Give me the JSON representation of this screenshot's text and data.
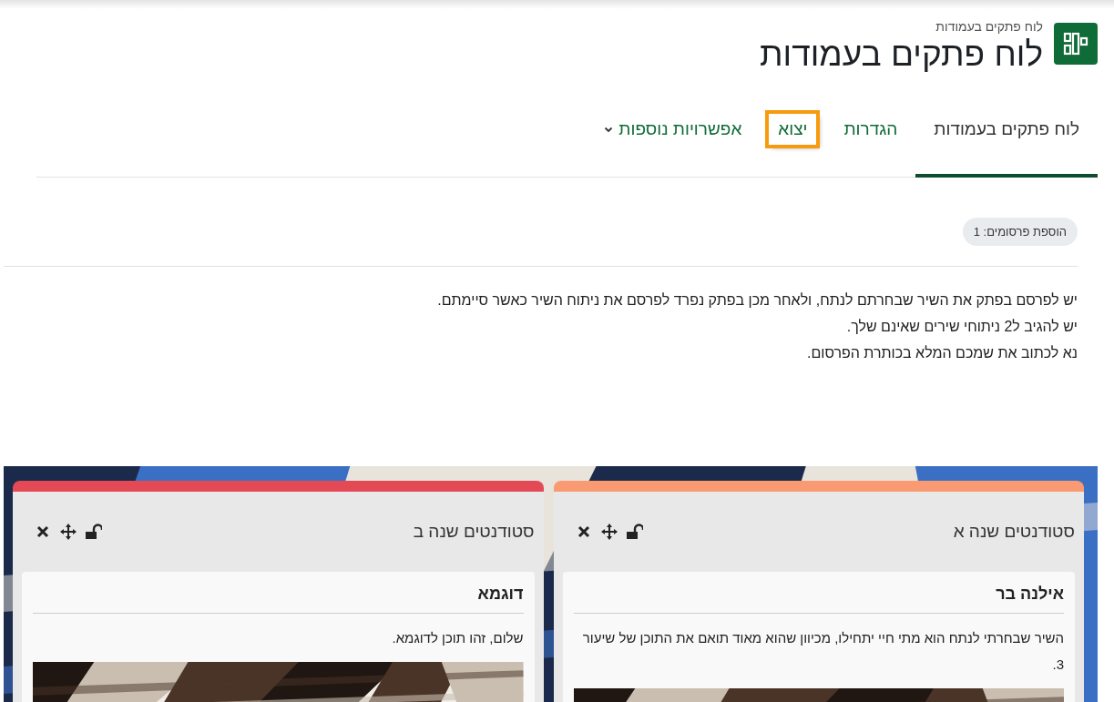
{
  "header": {
    "breadcrumb": "לוח פתקים בעמודות",
    "title": "לוח פתקים בעמודות"
  },
  "tabs": [
    {
      "label": "לוח פתקים בעמודות",
      "selected": true,
      "highlighted": false,
      "kind": "link"
    },
    {
      "label": "הגדרות",
      "selected": false,
      "highlighted": false,
      "kind": "link"
    },
    {
      "label": "יצוא",
      "selected": false,
      "highlighted": true,
      "kind": "link"
    },
    {
      "label": "אפשרויות נוספות",
      "selected": false,
      "highlighted": false,
      "kind": "menu"
    }
  ],
  "badge": "הוספת פרסומים: 1",
  "instructions": [
    "יש לפרסם בפתק את השיר שבחרתם לנתח, ולאחר מכן בפתק נפרד לפרסם את ניתוח השיר כאשר סיימתם.",
    "יש להגיב ל2 ניתוחי שירים שאינם שלך.",
    "נא לכתוב את שמכם המלא בכותרת הפרסום."
  ],
  "columns": [
    {
      "title": "סטודנטים שנה א",
      "color": "#f99a72",
      "locked": false,
      "notes": [
        {
          "title": "אילנה בר",
          "text": "השיר שבחרתי לנתח הוא מתי חיי יתחילו, מכיוון שהוא מאוד תואם את התוכן של שיעור 3."
        }
      ]
    },
    {
      "title": "סטודנטים שנה ב",
      "color": "#e44a55",
      "locked": false,
      "notes": [
        {
          "title": "דוגמא",
          "text": "שלום, זהו תוכן לדוגמא."
        }
      ]
    }
  ]
}
